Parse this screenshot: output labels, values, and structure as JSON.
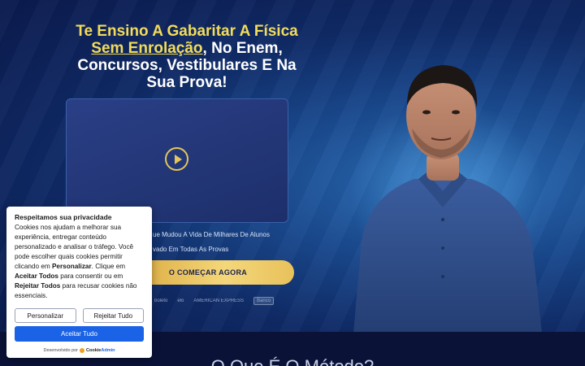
{
  "hero": {
    "headline_yellow": "Te Ensino A Gabaritar A Física",
    "headline_yellow_underlined": "Sem Enrolação",
    "headline_rest": ", No Enem, Concursos, Vestibulares E Na Sua Prova!",
    "bullet_1": "ue Mudou A Vida De Milhares De Alunos",
    "bullet_2": "vado Em Todas As Provas",
    "cta_label": "O COMEÇAR AGORA",
    "payments": [
      "boleto",
      "elo",
      "AMERICAN EXPRESS",
      "Banco"
    ]
  },
  "section": {
    "title": "O Que É O Método?"
  },
  "cookie": {
    "title": "Respeitamos sua privacidade",
    "text_1": "Cookies nos ajudam a melhorar sua experiência, entregar conteúdo personalizado e analisar o tráfego. Você pode escolher quais cookies permitir clicando em ",
    "bold_1": "Personalizar",
    "text_2": ". Clique em ",
    "bold_2": "Aceitar Todos",
    "text_3": " para consentir ou em ",
    "bold_3": "Rejeitar Todos",
    "text_4": " para recusar cookies não essenciais.",
    "customize_label": "Personalizar",
    "reject_label": "Rejeitar Tudo",
    "accept_label": "Aceitar Tudo",
    "powered_by": "Desenvolvido por",
    "brand_a": "Cookie",
    "brand_b": "Admin"
  },
  "colors": {
    "accent_yellow": "#f2dc5a",
    "cta_gold": "#e8c15a",
    "primary_blue": "#1a63e6",
    "hero_bg": "#0f2a66"
  }
}
